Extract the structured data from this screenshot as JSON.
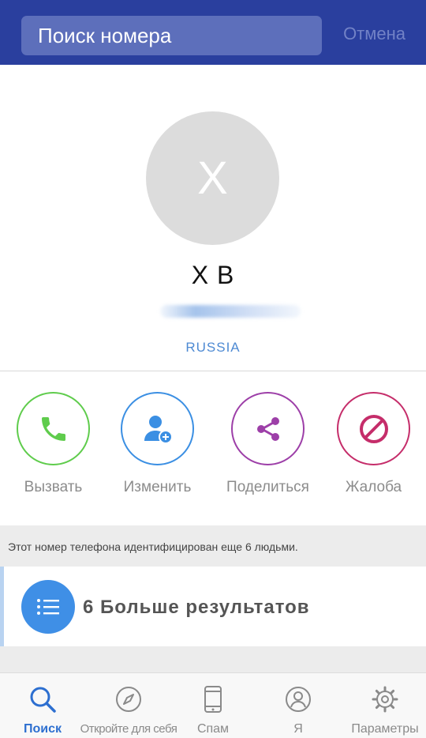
{
  "header": {
    "search_placeholder": "Поиск номера",
    "cancel_label": "Отмена"
  },
  "profile": {
    "initial": "X",
    "name": "X B",
    "country": "RUSSIA"
  },
  "actions": {
    "call": {
      "label": "Вызвать",
      "color": "#5fcc4c"
    },
    "edit": {
      "label": "Изменить",
      "color": "#3b8fe3"
    },
    "share": {
      "label": "Поделиться",
      "color": "#9d3fa8"
    },
    "report": {
      "label": "Жалоба",
      "color": "#c52d6a"
    }
  },
  "info": {
    "identified_text": "Этот номер телефона идентифицирован еще 6 людьми."
  },
  "more": {
    "label": "6 Больше результатов"
  },
  "tabbar": {
    "search": "Поиск",
    "discover": "Откройте для себя",
    "spam": "Спам",
    "me": "Я",
    "settings": "Параметры",
    "active_color": "#2d6fd0",
    "inactive_color": "#8a8a8a"
  }
}
